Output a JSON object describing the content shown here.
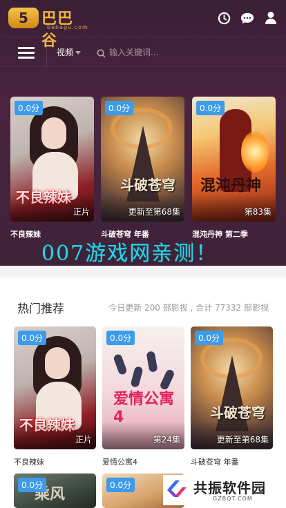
{
  "header": {
    "logo_badge": "5",
    "logo_text": "巴巴谷",
    "logo_sub": "babagu.com",
    "icons": [
      "clock-icon",
      "chat-icon",
      "user-icon"
    ]
  },
  "navbar": {
    "category": "视频",
    "search_placeholder": "输入关键词..."
  },
  "featured": [
    {
      "score": "0.0分",
      "status": "正片",
      "title": "不良辣妹",
      "art_text": "不良辣妹"
    },
    {
      "score": "0.0分",
      "status": "更新至第68集",
      "title": "斗破苍穹 年番",
      "art_text": "斗破苍穹"
    },
    {
      "score": "0.0分",
      "status": "第83集",
      "title": "混沌丹神 第二季",
      "art_text": "混沌丹神"
    }
  ],
  "watermark": "007游戏网亲测！",
  "hot": {
    "title": "热门推荐",
    "meta": "今日更新 200 部影视 , 合计 77332 部影视",
    "items": [
      {
        "score": "0.0分",
        "status": "正片",
        "title": "不良辣妹",
        "art_text": "不良辣妹"
      },
      {
        "score": "0.0分",
        "status": "第24集",
        "title": "爱情公寓4",
        "art_text": "爱情公寓4"
      },
      {
        "score": "0.0分",
        "status": "更新至第68集",
        "title": "斗破苍穹 年番",
        "art_text": "斗破苍穹"
      },
      {
        "score": "0.0分",
        "status": "",
        "title": "",
        "art_text": "乘风"
      },
      {
        "score": "0.0分",
        "status": "",
        "title": "",
        "art_text": ""
      }
    ]
  },
  "corner_brand": {
    "name": "共振软件园",
    "domain": "GZBQT.COM"
  },
  "colors": {
    "header_bg": "#3f2238",
    "score_badge": "#3d9be9",
    "logo_gold": "#f0b63a",
    "watermark": "#26d3e8"
  }
}
